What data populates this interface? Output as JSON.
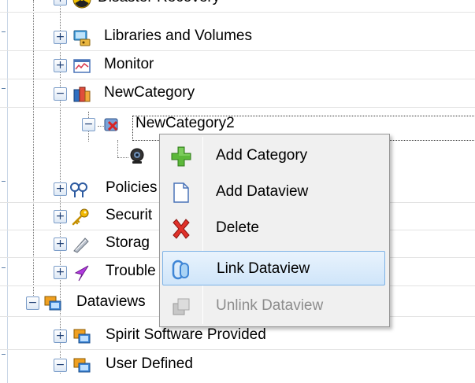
{
  "tree": {
    "items": [
      {
        "label": "Disaster Recovery",
        "icon": "radiation-icon"
      },
      {
        "label": "Libraries and Volumes",
        "icon": "library-icon"
      },
      {
        "label": "Monitor",
        "icon": "monitor-icon"
      },
      {
        "label": "NewCategory",
        "icon": "category-icon"
      },
      {
        "label": "NewCategory2",
        "icon": "category-icon"
      },
      {
        "label": "",
        "icon": "webcam-icon"
      },
      {
        "label": "Policies",
        "icon": "policies-icon"
      },
      {
        "label": "Securit",
        "icon": "key-icon"
      },
      {
        "label": "Storag",
        "icon": "storage-icon"
      },
      {
        "label": "Trouble",
        "icon": "flag-icon"
      },
      {
        "label": "Dataviews",
        "icon": "dataviews-icon"
      },
      {
        "label": "Spirit Software Provided",
        "icon": "dataviews-icon"
      },
      {
        "label": "User Defined",
        "icon": "dataviews-icon"
      }
    ]
  },
  "context_menu": {
    "items": [
      {
        "label": "Add Category",
        "icon": "plus-icon",
        "enabled": true
      },
      {
        "label": "Add Dataview",
        "icon": "document-icon",
        "enabled": true
      },
      {
        "label": "Delete",
        "icon": "delete-icon",
        "enabled": true
      },
      {
        "label": "Link Dataview",
        "icon": "link-icon",
        "enabled": true,
        "highlighted": true
      },
      {
        "label": "Unlink Dataview",
        "icon": "unlink-icon",
        "enabled": false
      }
    ]
  },
  "colors": {
    "selection_border": "#7db2e6",
    "expander_border": "#7a9cc8",
    "menu_bg": "#f0f0f0",
    "disabled_text": "#8d8d8d"
  }
}
